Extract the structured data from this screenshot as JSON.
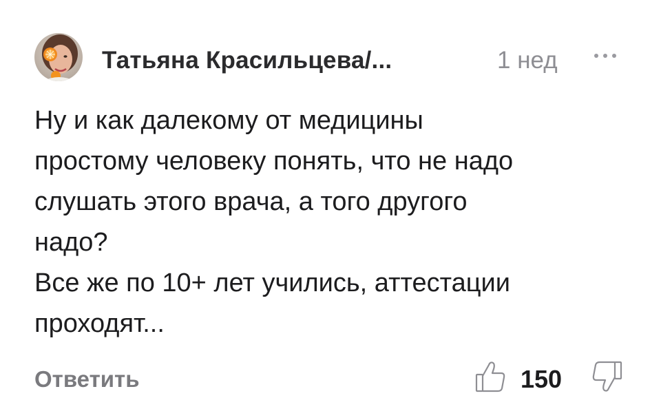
{
  "comment": {
    "author": "Татьяна Красильцева/...",
    "time": "1 нед",
    "more_icon": "more-horizontal-icon",
    "text": "Ну и как далекому от медицины\nпростому человеку понять, что не надо\nслушать этого врача, а того другого\nнадо?\nВсе же по 10+ лет учились, аттестации\nпроходят...",
    "reply_label": "Ответить",
    "like_icon": "thumbs-up-icon",
    "like_count": "150",
    "dislike_icon": "thumbs-down-icon"
  },
  "colors": {
    "text": "#1c1c1e",
    "secondary": "#8e8e93",
    "reply": "#7a7a7e",
    "icon_stroke": "#8e8e93"
  }
}
